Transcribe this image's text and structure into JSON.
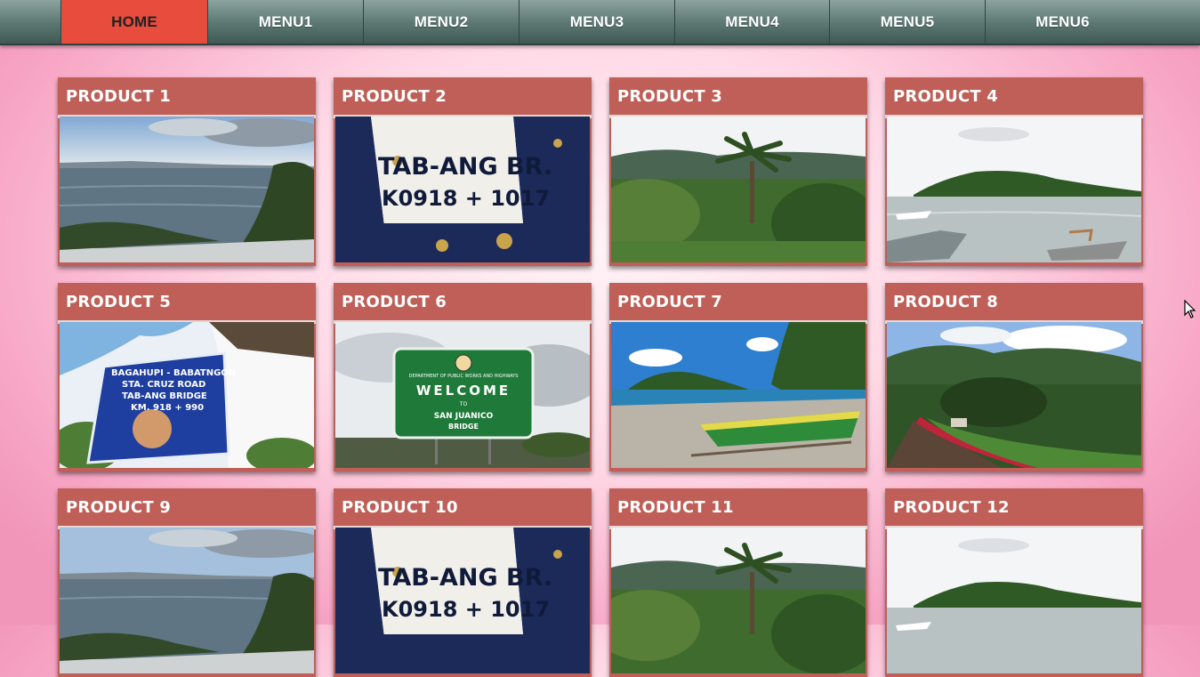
{
  "nav": {
    "items": [
      {
        "label": "HOME",
        "active": true
      },
      {
        "label": "MENU1",
        "active": false
      },
      {
        "label": "MENU2",
        "active": false
      },
      {
        "label": "MENU3",
        "active": false
      },
      {
        "label": "MENU4",
        "active": false
      },
      {
        "label": "MENU5",
        "active": false
      },
      {
        "label": "MENU6",
        "active": false
      }
    ]
  },
  "products": [
    {
      "title": "PRODUCT 1",
      "image": "sea-view"
    },
    {
      "title": "PRODUCT 2",
      "image": "bridge-marker"
    },
    {
      "title": "PRODUCT 3",
      "image": "palm-jungle"
    },
    {
      "title": "PRODUCT 4",
      "image": "island-bay"
    },
    {
      "title": "PRODUCT 5",
      "image": "road-sign"
    },
    {
      "title": "PRODUCT 6",
      "image": "welcome-sign"
    },
    {
      "title": "PRODUCT 7",
      "image": "beach-boats"
    },
    {
      "title": "PRODUCT 8",
      "image": "hill-garden"
    },
    {
      "title": "PRODUCT 9",
      "image": "sea-view"
    },
    {
      "title": "PRODUCT 10",
      "image": "bridge-marker"
    },
    {
      "title": "PRODUCT 11",
      "image": "palm-jungle"
    },
    {
      "title": "PRODUCT 12",
      "image": "island-bay"
    }
  ],
  "photo_text": {
    "bridge_line1": "TAB-ANG BR.",
    "bridge_line2": "K0918 + 1017",
    "road_sign": [
      "BAGAHUPI - BABATNGON",
      "STA. CRUZ ROAD",
      "TAB-ANG BRIDGE",
      "KM. 918 + 990"
    ],
    "welcome_dept": "DEPARTMENT OF PUBLIC WORKS AND HIGHWAYS",
    "welcome": "WELCOME",
    "welcome_to": "TO",
    "welcome_place1": "SAN JUANICO",
    "welcome_place2": "BRIDGE"
  },
  "colors": {
    "nav_active": "#e74c3c",
    "card_header": "#bf5f57",
    "nav_bar": "#5f7a74"
  }
}
